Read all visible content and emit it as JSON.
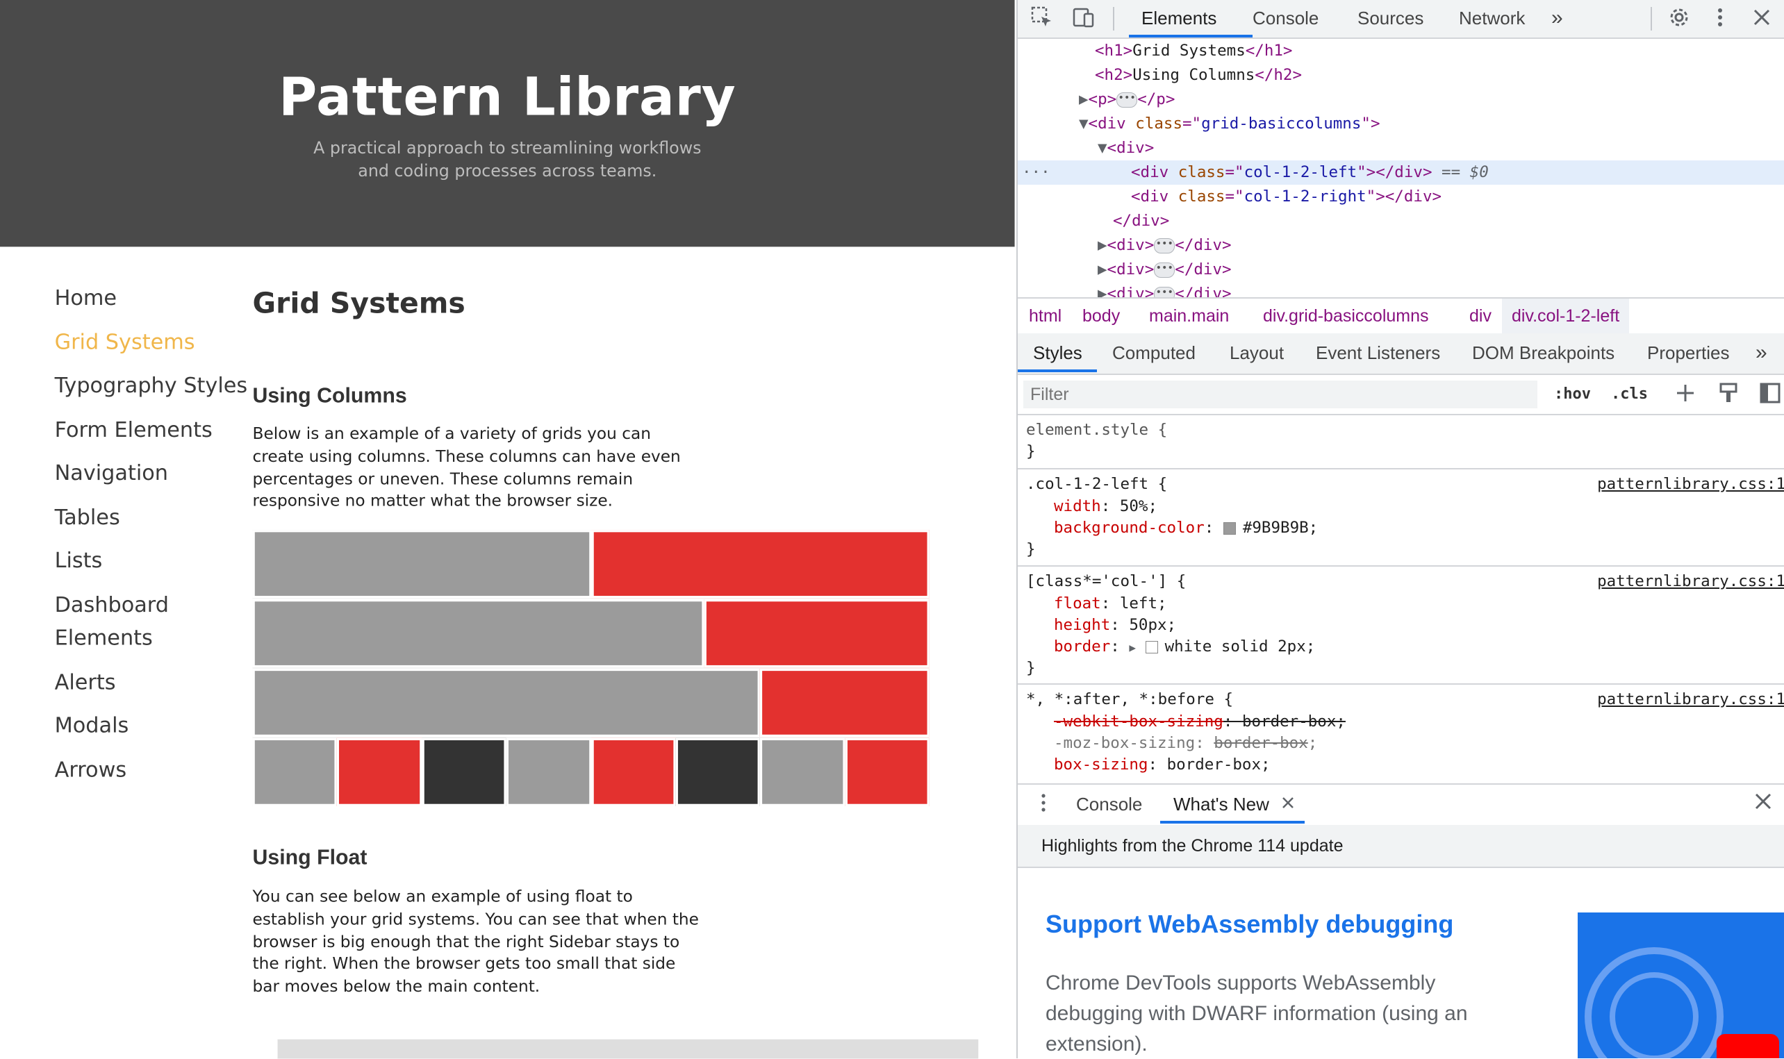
{
  "page": {
    "title": "Pattern Library",
    "tagline_lines": [
      "A practical approach to streamlining workflows",
      "and coding processes across teams."
    ],
    "nav": [
      "Home",
      "Grid Systems",
      "Typography Styles",
      "Form Elements",
      "Navigation",
      "Tables",
      "Lists",
      "Dashboard Elements",
      "Alerts",
      "Modals",
      "Arrows"
    ],
    "active_nav": "Grid Systems",
    "heading": "Grid Systems",
    "section1_title": "Using Columns",
    "section1_text": "Below is an example of a variety of grids you can create using columns. These columns can have even percentages or uneven. These columns remain responsive no matter what the browser size.",
    "section2_title": "Using Float",
    "section2_text": "You can see below an example of using float to establish your grid systems. You can see that when the browser is big enough that the right Sidebar stays to the right. When the browser gets too small that side bar moves below the main content.",
    "colors": {
      "grey": "#9B9B9B",
      "red": "#E3312F",
      "dark": "#333333",
      "nav_active": "#F0B64A",
      "hero_bg": "#4A4A4A"
    },
    "grid_rows": [
      [
        {
          "w": 0.5,
          "c": "grey"
        },
        {
          "w": 0.5,
          "c": "red"
        }
      ],
      [
        {
          "w": 0.6667,
          "c": "grey"
        },
        {
          "w": 0.3333,
          "c": "red"
        }
      ],
      [
        {
          "w": 0.75,
          "c": "grey"
        },
        {
          "w": 0.25,
          "c": "red"
        }
      ],
      [
        {
          "w": 0.125,
          "c": "grey"
        },
        {
          "w": 0.125,
          "c": "red"
        },
        {
          "w": 0.125,
          "c": "dark"
        },
        {
          "w": 0.125,
          "c": "grey"
        },
        {
          "w": 0.125,
          "c": "red"
        },
        {
          "w": 0.125,
          "c": "dark"
        },
        {
          "w": 0.125,
          "c": "grey"
        },
        {
          "w": 0.125,
          "c": "red"
        }
      ]
    ]
  },
  "devtools": {
    "tabs": [
      "Elements",
      "Console",
      "Sources",
      "Network"
    ],
    "active_tab": "Elements",
    "more": "»",
    "dom": {
      "h1": "Grid Systems",
      "h2": "Using Columns",
      "div_class": "grid-basiccolumns",
      "col_left": "col-1-2-left",
      "col_right": "col-1-2-right",
      "sel_marker": "== $0"
    },
    "breadcrumb": [
      "html",
      "body",
      "main.main",
      "div.grid-basiccolumns",
      "div",
      "div.col-1-2-left"
    ],
    "styles_tabs": [
      "Styles",
      "Computed",
      "Layout",
      "Event Listeners",
      "DOM Breakpoints",
      "Properties"
    ],
    "filter_placeholder": "Filter",
    "hov": ":hov",
    "cls": ".cls",
    "rules": {
      "element_style": "element.style {",
      "r1_selector": ".col-1-2-left {",
      "r1_width": "50%;",
      "r1_bg": "#9B9B9B;",
      "r2_selector": "[class*='col-'] {",
      "r2_float": "left;",
      "r2_height": "50px;",
      "r2_border": "white solid 2px;",
      "r3_selector": "*, *:after, *:before {",
      "r3_wk": "-webkit-box-sizing",
      "r3_wk_val": "border-box;",
      "r3_moz": "-moz-box-sizing:",
      "r3_moz_val": "border-box",
      "r3_bs": "box-sizing",
      "r3_bs_val": "border-box;",
      "source": "patternlibrary.css:1"
    },
    "drawer_tabs": [
      "Console",
      "What's New"
    ],
    "highlights": "Highlights from the Chrome 114 update",
    "whatsnew_title": "Support WebAssembly debugging",
    "whatsnew_body": "Chrome DevTools supports WebAssembly debugging with DWARF information (using an extension).",
    "colors": {
      "accent": "#1A73E8",
      "tag": "#881280",
      "attr": "#994500",
      "attr_val": "#1A1AA6",
      "prop": "#C80000"
    }
  }
}
